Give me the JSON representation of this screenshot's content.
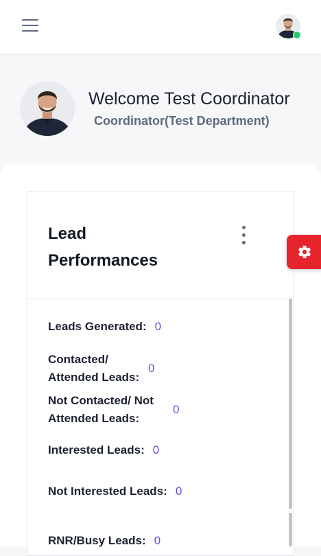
{
  "user": {
    "welcome_text": "Welcome Test Coordinator",
    "role_text": "Coordinator(Test Department)",
    "online": true
  },
  "card": {
    "title": "Lead Performances",
    "stats": [
      {
        "label": "Leads Generated:",
        "value": "0"
      },
      {
        "label": "Contacted/ Attended Leads:",
        "value": "0"
      },
      {
        "label": "Not Contacted/ Not Attended Leads:",
        "value": "0"
      },
      {
        "label": "Interested Leads:",
        "value": "0"
      },
      {
        "label": "Not Interested Leads:",
        "value": "0"
      },
      {
        "label": "RNR/Busy Leads:",
        "value": "0"
      }
    ]
  },
  "icons": {
    "menu": "hamburger-icon",
    "more": "kebab-icon",
    "settings": "gear-icon"
  },
  "colors": {
    "accent_value": "#5e55d9",
    "settings_button": "#e5242c",
    "online_dot": "#28c76f",
    "text_dark": "#1c2230",
    "text_muted": "#5c6a7d"
  }
}
